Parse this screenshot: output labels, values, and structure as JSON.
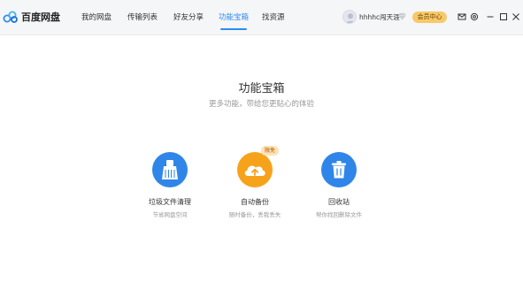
{
  "app": {
    "logo_text": "百度网盘"
  },
  "nav": [
    {
      "label": "我的网盘"
    },
    {
      "label": "传输列表"
    },
    {
      "label": "好友分享"
    },
    {
      "label": "功能宝箱",
      "active": true
    },
    {
      "label": "找资源"
    }
  ],
  "user": {
    "name": "hhhhc闯天涯",
    "vip_label": "会员中心"
  },
  "icons": {
    "logo": "baidu-cloud-logo",
    "mail": "mail-icon",
    "settings": "gear-icon",
    "minimize": "minimize-icon",
    "maximize": "maximize-icon",
    "close": "close-icon"
  },
  "colors": {
    "accent": "#2d8cf0",
    "trash_clean": "#2f86e8",
    "auto_backup": "#f7a21b",
    "recycle_bin": "#2f86e8",
    "badge_bg": "#fde2b8",
    "vip_bg": "#f7c96a"
  },
  "main": {
    "title": "功能宝箱",
    "subtitle": "更多功能，带给您更贴心的体验",
    "tools": [
      {
        "name": "垃圾文件清理",
        "desc": "节省网盘空间",
        "icon": "broom-icon"
      },
      {
        "name": "自动备份",
        "desc": "随时备份，丢我丢失",
        "icon": "cloud-upload-icon",
        "badge": "限免"
      },
      {
        "name": "回收站",
        "desc": "帮你找回删除文件",
        "icon": "trash-icon"
      }
    ]
  }
}
